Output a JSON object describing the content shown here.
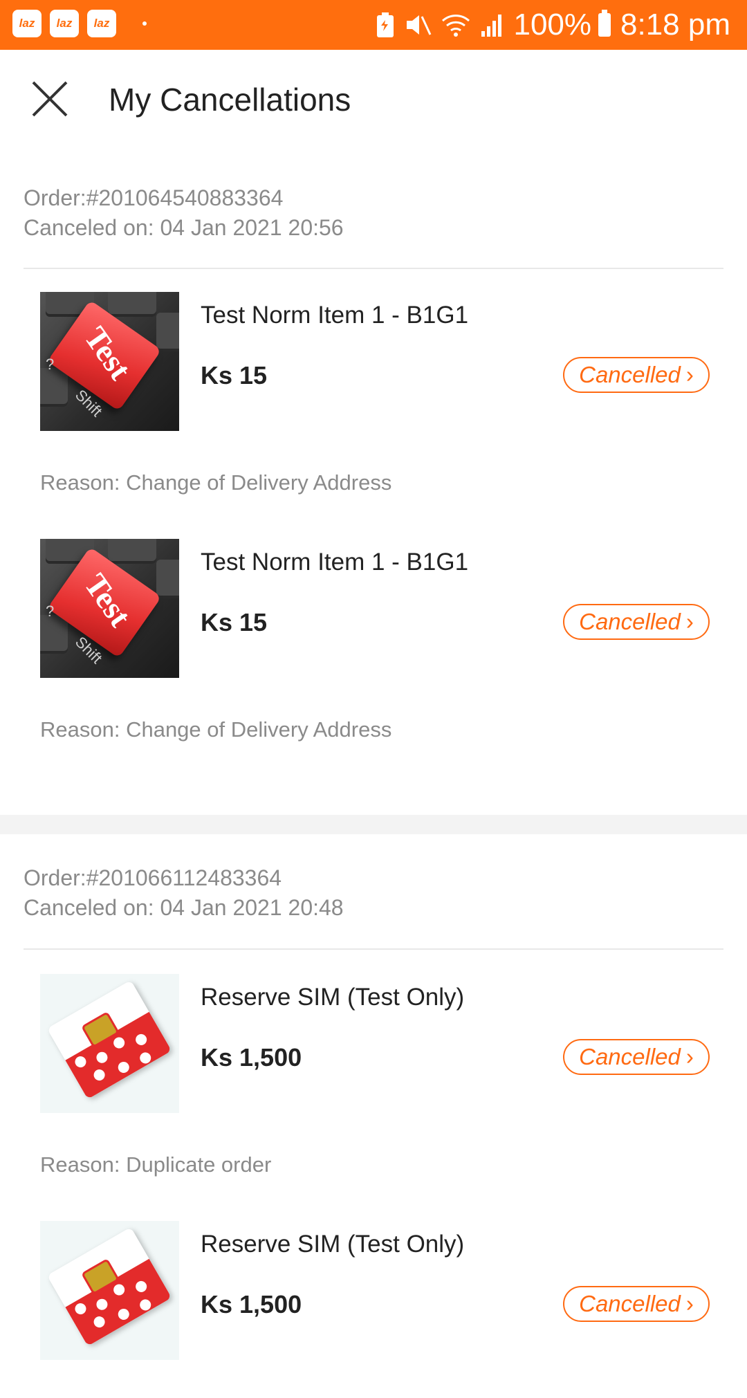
{
  "status_bar": {
    "app_icons": [
      "laz",
      "laz",
      "laz"
    ],
    "battery": "100%",
    "time": "8:18 pm"
  },
  "header": {
    "title": "My Cancellations",
    "close_icon": "close-icon"
  },
  "orders": [
    {
      "order_label": "Order:#201064540883364",
      "canceled_on": "Canceled on: 04 Jan 2021 20:56",
      "items": [
        {
          "title": "Test Norm Item 1 - B1G1",
          "price": "Ks 15",
          "status": "Cancelled",
          "reason": "Reason: Change of Delivery Address",
          "image": "keyboard-test-key"
        },
        {
          "title": "Test Norm Item 1 - B1G1",
          "price": "Ks 15",
          "status": "Cancelled",
          "reason": "Reason: Change of Delivery Address",
          "image": "keyboard-test-key"
        }
      ]
    },
    {
      "order_label": "Order:#201066112483364",
      "canceled_on": "Canceled on: 04 Jan 2021 20:48",
      "items": [
        {
          "title": "Reserve SIM (Test Only)",
          "price": "Ks 1,500",
          "status": "Cancelled",
          "reason": "Reason: Duplicate order",
          "image": "sim-card"
        },
        {
          "title": "Reserve SIM (Test Only)",
          "price": "Ks 1,500",
          "status": "Cancelled",
          "image": "sim-card"
        }
      ]
    }
  ],
  "colors": {
    "status_bar": "#ff6e0e",
    "accent": "#ff6a12",
    "muted_text": "#8a8a8a",
    "section_gap": "#f3f3f3"
  }
}
